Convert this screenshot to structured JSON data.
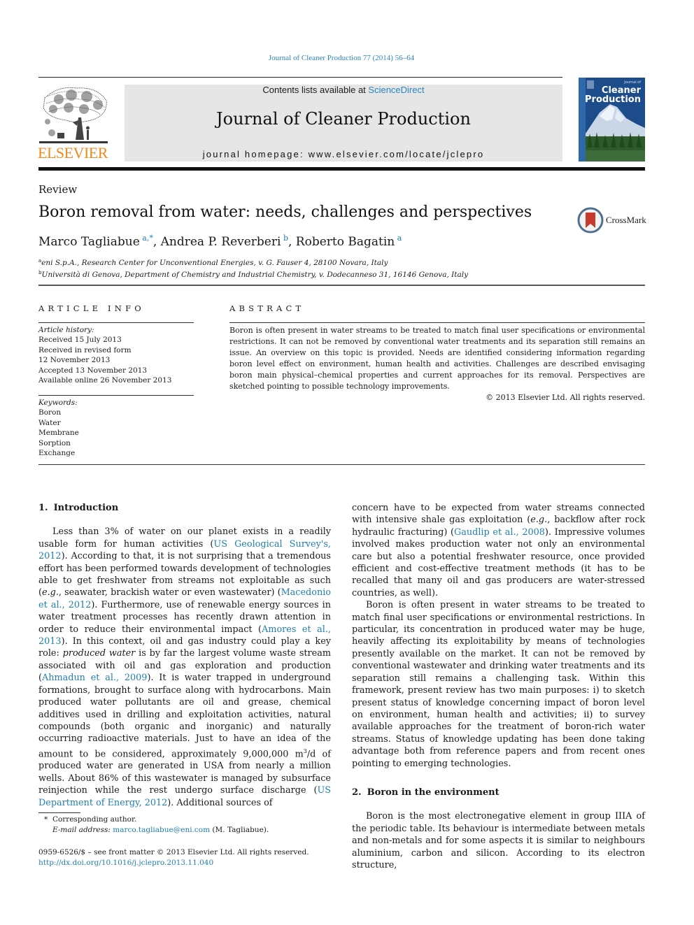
{
  "header": {
    "citation": "Journal of Cleaner Production 77 (2014) 56–64",
    "contents_prefix": "Contents lists available at ",
    "contents_link": "ScienceDirect",
    "journal_title": "Journal of Cleaner Production",
    "homepage_prefix": "journal homepage: ",
    "homepage_url": "www.elsevier.com/locate/jclepro",
    "publisher_logo": "ELSEVIER",
    "cover": {
      "small_text": "Journal of",
      "title_line1": "Cleaner",
      "title_line2": "Production"
    }
  },
  "article": {
    "type": "Review",
    "title": "Boron removal from water: needs, challenges and perspectives",
    "crossmark_label": "CrossMark",
    "authors": [
      {
        "name": "Marco Tagliabue",
        "sup": "a,*"
      },
      {
        "name": "Andrea P. Reverberi",
        "sup": "b"
      },
      {
        "name": "Roberto Bagatin",
        "sup": "a"
      }
    ],
    "affiliations": [
      {
        "mark": "a",
        "text": "eni S.p.A., Research Center for Unconventional Energies, v. G. Fauser 4, 28100 Novara, Italy"
      },
      {
        "mark": "b",
        "text": "Università di Genova, Department of Chemistry and Industrial Chemistry, v. Dodecanneso 31, 16146 Genova, Italy"
      }
    ]
  },
  "article_info": {
    "heading": "ARTICLE INFO",
    "history_label": "Article history:",
    "history": [
      "Received 15 July 2013",
      "Received in revised form",
      "12 November 2013",
      "Accepted 13 November 2013",
      "Available online 26 November 2013"
    ],
    "keywords_label": "Keywords:",
    "keywords": [
      "Boron",
      "Water",
      "Membrane",
      "Sorption",
      "Exchange"
    ]
  },
  "abstract": {
    "heading": "ABSTRACT",
    "text": "Boron is often present in water streams to be treated to match final user specifications or environmental restrictions. It can not be removed by conventional water treatments and its separation still remains an issue. An overview on this topic is provided. Needs are identified considering information regarding boron level effect on environment, human health and activities. Challenges are described envisaging boron main physical–chemical properties and current approaches for its removal. Perspectives are sketched pointing to possible technology improvements.",
    "copyright": "© 2013 Elsevier Ltd. All rights reserved."
  },
  "sections": {
    "intro": {
      "number": "1.",
      "title": "Introduction",
      "p1": [
        "Less than 3% of water on our planet exists in a readily usable form for human activities (",
        "US Geological Survey's, 2012",
        "). According to that, it is not surprising that a tremendous effort has been per­formed towards development of technologies able to get fresh­water from streams not exploitable as such (",
        "e.g.",
        ", seawater, brackish water or even wastewater) (",
        "Macedonio et al., 2012",
        "). Furthermore, use of renewable energy sources in water treatment processes has recently drawn attention in order to reduce their environmental impact (",
        "Amores et al., 2013",
        "). In this context, oil and gas industry could play a key role: ",
        "produced water",
        " is by far the largest volume waste stream associated with oil and gas exploration and produc­tion (",
        "Ahmadun et al., 2009",
        "). It is water trapped in underground formations, brought to surface along with hydrocarbons. Main produced water pollutants are oil and grease, chemical additives used in drilling and exploitation activities, natural compounds (both organic and inorganic) and naturally occurring radioactive materials. Just to have an idea of the amount to be considered, approximately 9,000,000 m",
        "3",
        "/d of produced water are generated in USA from nearly a million wells. About 86% of this wastewater is managed by subsurface reinjection while the rest undergo surface discharge (",
        "US Department of Energy, 2012",
        "). Additional sources of "
      ],
      "p1_cont": [
        "concern have to be expected from water streams connected with intensive shale gas exploitation (",
        "e.g.",
        ", backflow after rock hydraulic fracturing) (",
        "Gaudlip et al., 2008",
        "). Impressive volumes involved makes production water not only an environmental care but also a potential freshwater resource, once provided efficient and cost-effective treatment methods (it has to be recalled that many oil and gas producers are water-stressed countries, as well)."
      ],
      "p2": "Boron is often present in water streams to be treated to match final user specifications or environmental restrictions. In particular, its concentration in produced water may be huge, heavily affecting its exploitability by means of technologies presently available on the market. It can not be removed by conventional wastewater and drinking water treatments and its separation still remains a chal­lenging task. Within this framework, present review has two main purposes: i) to sketch present status of knowledge concerning impact of boron level on environment, human health and activities; ii) to survey available approaches for the treatment of boron-rich water streams. Status of knowledge updating has been done tak­ing advantage both from reference papers and from recent ones pointing to emerging technologies."
    },
    "environment": {
      "number": "2.",
      "title": "Boron in the environment",
      "p1": "Boron is the most electronegative element in group IIIA of the periodic table. Its behaviour is intermediate between metals and non-metals and for some aspects it is similar to neighbours aluminium, carbon and silicon. According to its electron structure,"
    }
  },
  "footnotes": {
    "corresponding_mark": "*",
    "corresponding": "Corresponding author.",
    "email_label": "E-mail address:",
    "email": "marco.tagliabue@eni.com",
    "email_suffix": " (M. Tagliabue).",
    "issn_line": "0959-6526/$ – see front matter © 2013 Elsevier Ltd. All rights reserved.",
    "doi": "http://dx.doi.org/10.1016/j.jclepro.2013.11.040"
  },
  "colors": {
    "link": "#1f7fb0",
    "elsevier_orange": "#f08a1c",
    "header_gray": "#e6e6e6"
  }
}
